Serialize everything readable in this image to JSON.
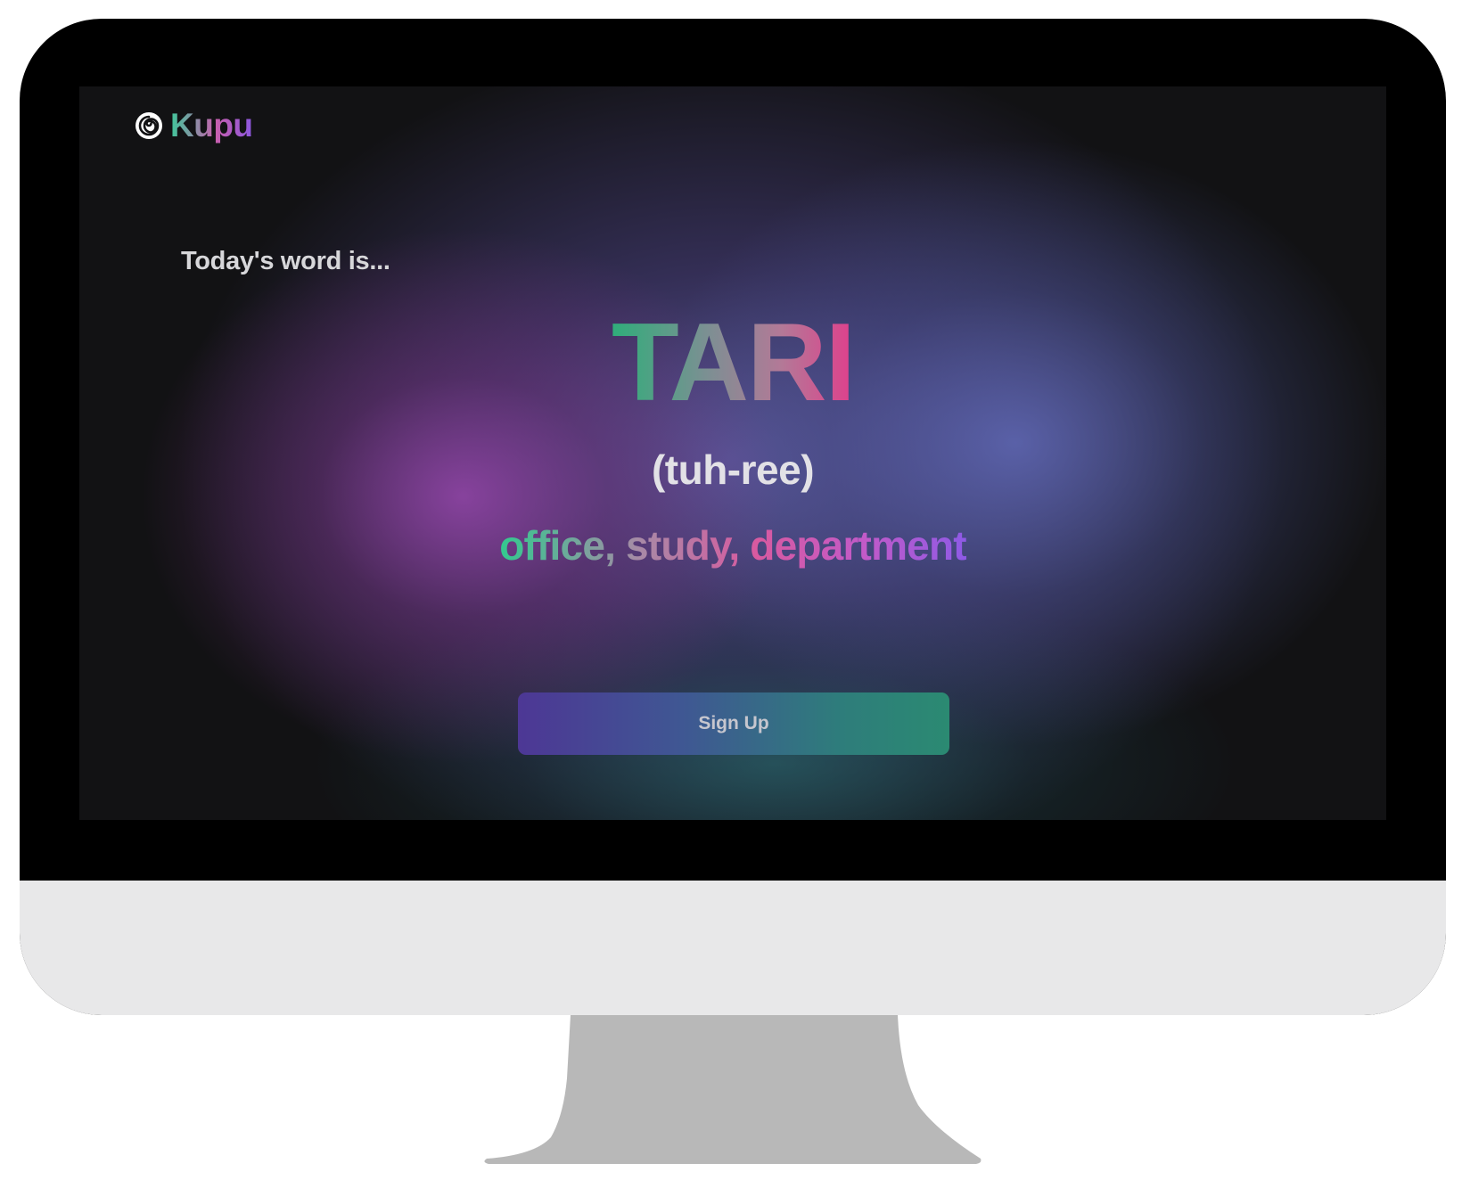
{
  "brand": {
    "name": "Kupu",
    "icon": "swirl-icon"
  },
  "hero": {
    "intro": "Today's word is...",
    "word": "TARI",
    "pronunciation": "(tuh-ree)",
    "meaning": "office, study, department"
  },
  "cta": {
    "signup_label": "Sign Up"
  },
  "colors": {
    "background": "#121214",
    "accent_green": "#33c98f",
    "accent_pink": "#e03f8c",
    "accent_purple": "#8e5ae6",
    "button_start": "#4d3795",
    "button_end": "#2b8a72"
  }
}
